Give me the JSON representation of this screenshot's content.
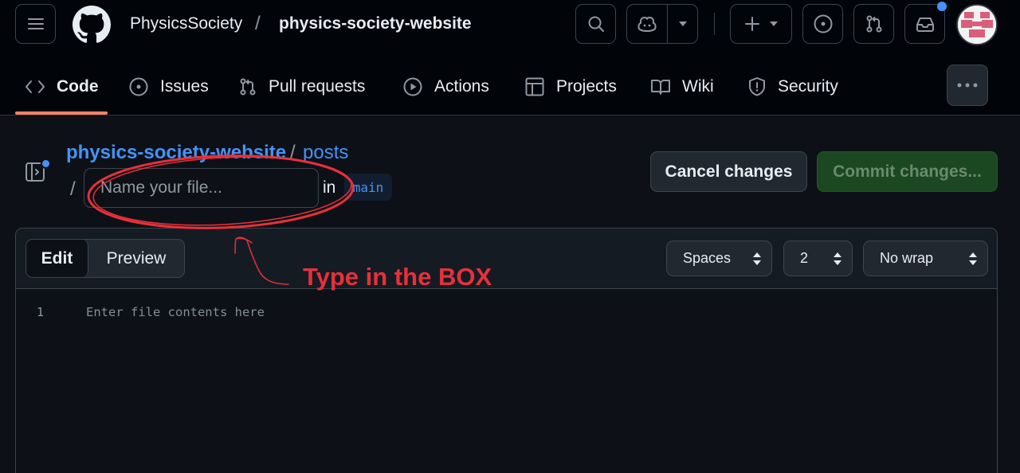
{
  "header": {
    "owner": "PhysicsSociety",
    "separator": "/",
    "repo": "physics-society-website"
  },
  "tabs": [
    {
      "label": "Code",
      "icon": "code-icon",
      "active": true
    },
    {
      "label": "Issues",
      "icon": "issue-opened-icon"
    },
    {
      "label": "Pull requests",
      "icon": "git-pull-request-icon"
    },
    {
      "label": "Actions",
      "icon": "play-icon"
    },
    {
      "label": "Projects",
      "icon": "table-icon"
    },
    {
      "label": "Wiki",
      "icon": "book-icon"
    },
    {
      "label": "Security",
      "icon": "shield-icon"
    }
  ],
  "breadcrumb": {
    "repo": "physics-society-website",
    "separator": "/",
    "directory": "posts",
    "lead_slash": "/"
  },
  "filename": {
    "placeholder": "Name your file...",
    "value": ""
  },
  "branch": {
    "in_label": "in",
    "name": "main"
  },
  "actions": {
    "cancel_label": "Cancel changes",
    "commit_label": "Commit changes..."
  },
  "editor": {
    "mode_edit": "Edit",
    "mode_preview": "Preview",
    "indent_mode": "Spaces",
    "indent_size": "2",
    "wrap_mode": "No wrap",
    "line_number": "1",
    "placeholder": "Enter file contents here"
  },
  "annotation": {
    "text": "Type in the BOX",
    "color": "#e8303a"
  },
  "colors": {
    "accent": "#4493f8",
    "active_tab_underline": "#f78166",
    "commit_button": "#1b4721",
    "background": "#0d1117"
  }
}
